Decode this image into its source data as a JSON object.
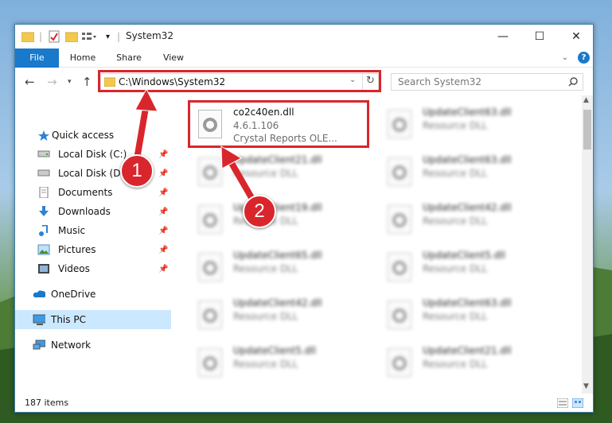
{
  "window": {
    "title": "System32",
    "controls": {
      "minimize": "—",
      "maximize": "☐",
      "close": "✕"
    }
  },
  "ribbon": {
    "tabs": [
      {
        "label": "File",
        "active": true
      },
      {
        "label": "Home",
        "active": false
      },
      {
        "label": "Share",
        "active": false
      },
      {
        "label": "View",
        "active": false
      }
    ],
    "help_label": "?"
  },
  "address_bar": {
    "path": "C:\\Windows\\System32",
    "search_placeholder": "Search System32"
  },
  "navigation": {
    "quick_access": "Quick access",
    "items": [
      {
        "label": "Local Disk (C:)",
        "icon": "drive-icon",
        "pinned": true
      },
      {
        "label": "Local Disk (D:)",
        "icon": "drive-icon",
        "pinned": true
      },
      {
        "label": "Documents",
        "icon": "documents-icon",
        "pinned": true
      },
      {
        "label": "Downloads",
        "icon": "download-icon",
        "pinned": true
      },
      {
        "label": "Music",
        "icon": "music-icon",
        "pinned": true
      },
      {
        "label": "Pictures",
        "icon": "pictures-icon",
        "pinned": true
      },
      {
        "label": "Videos",
        "icon": "videos-icon",
        "pinned": true
      }
    ],
    "onedrive": "OneDrive",
    "this_pc": "This PC",
    "network": "Network"
  },
  "files": [
    {
      "name": "co2c40en.dll",
      "line2": "4.6.1.106",
      "line3": "Crystal Reports OLE...",
      "highlighted": true
    },
    {
      "name": "UpdateClient63.dll",
      "line2": "Resource DLL"
    },
    {
      "name": "UpdateClient21.dll",
      "line2": "Resource DLL"
    },
    {
      "name": "UpdateClient63.dll",
      "line2": "Resource DLL"
    },
    {
      "name": "UpdateClient19.dll",
      "line2": "Resource DLL"
    },
    {
      "name": "UpdateClient42.dll",
      "line2": "Resource DLL"
    },
    {
      "name": "UpdateClient65.dll",
      "line2": "Resource DLL"
    },
    {
      "name": "UpdateClient5.dll",
      "line2": "Resource DLL"
    },
    {
      "name": "UpdateClient42.dll",
      "line2": "Resource DLL"
    },
    {
      "name": "UpdateClient63.dll",
      "line2": "Resource DLL"
    },
    {
      "name": "UpdateClient5.dll",
      "line2": "Resource DLL"
    },
    {
      "name": "UpdateClient21.dll",
      "line2": "Resource DLL"
    }
  ],
  "status": {
    "count": "187 items"
  },
  "annotations": {
    "callout1": "1",
    "callout2": "2",
    "color": "#d9262c"
  }
}
